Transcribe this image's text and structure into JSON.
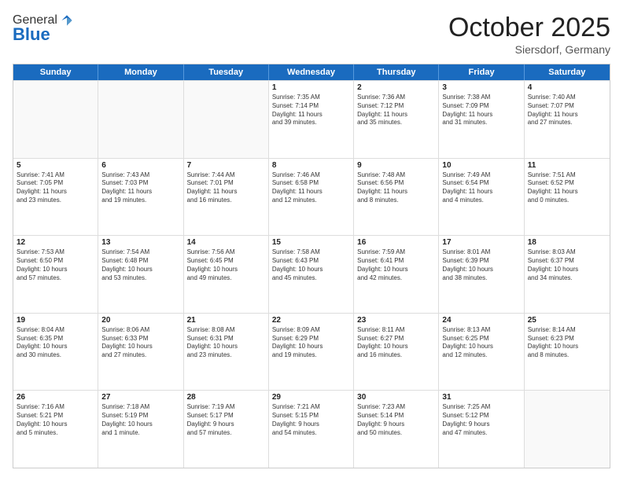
{
  "header": {
    "logo_general": "General",
    "logo_blue": "Blue",
    "title": "October 2025",
    "location": "Siersdorf, Germany"
  },
  "weekdays": [
    "Sunday",
    "Monday",
    "Tuesday",
    "Wednesday",
    "Thursday",
    "Friday",
    "Saturday"
  ],
  "rows": [
    [
      {
        "day": "",
        "info": ""
      },
      {
        "day": "",
        "info": ""
      },
      {
        "day": "",
        "info": ""
      },
      {
        "day": "1",
        "info": "Sunrise: 7:35 AM\nSunset: 7:14 PM\nDaylight: 11 hours\nand 39 minutes."
      },
      {
        "day": "2",
        "info": "Sunrise: 7:36 AM\nSunset: 7:12 PM\nDaylight: 11 hours\nand 35 minutes."
      },
      {
        "day": "3",
        "info": "Sunrise: 7:38 AM\nSunset: 7:09 PM\nDaylight: 11 hours\nand 31 minutes."
      },
      {
        "day": "4",
        "info": "Sunrise: 7:40 AM\nSunset: 7:07 PM\nDaylight: 11 hours\nand 27 minutes."
      }
    ],
    [
      {
        "day": "5",
        "info": "Sunrise: 7:41 AM\nSunset: 7:05 PM\nDaylight: 11 hours\nand 23 minutes."
      },
      {
        "day": "6",
        "info": "Sunrise: 7:43 AM\nSunset: 7:03 PM\nDaylight: 11 hours\nand 19 minutes."
      },
      {
        "day": "7",
        "info": "Sunrise: 7:44 AM\nSunset: 7:01 PM\nDaylight: 11 hours\nand 16 minutes."
      },
      {
        "day": "8",
        "info": "Sunrise: 7:46 AM\nSunset: 6:58 PM\nDaylight: 11 hours\nand 12 minutes."
      },
      {
        "day": "9",
        "info": "Sunrise: 7:48 AM\nSunset: 6:56 PM\nDaylight: 11 hours\nand 8 minutes."
      },
      {
        "day": "10",
        "info": "Sunrise: 7:49 AM\nSunset: 6:54 PM\nDaylight: 11 hours\nand 4 minutes."
      },
      {
        "day": "11",
        "info": "Sunrise: 7:51 AM\nSunset: 6:52 PM\nDaylight: 11 hours\nand 0 minutes."
      }
    ],
    [
      {
        "day": "12",
        "info": "Sunrise: 7:53 AM\nSunset: 6:50 PM\nDaylight: 10 hours\nand 57 minutes."
      },
      {
        "day": "13",
        "info": "Sunrise: 7:54 AM\nSunset: 6:48 PM\nDaylight: 10 hours\nand 53 minutes."
      },
      {
        "day": "14",
        "info": "Sunrise: 7:56 AM\nSunset: 6:45 PM\nDaylight: 10 hours\nand 49 minutes."
      },
      {
        "day": "15",
        "info": "Sunrise: 7:58 AM\nSunset: 6:43 PM\nDaylight: 10 hours\nand 45 minutes."
      },
      {
        "day": "16",
        "info": "Sunrise: 7:59 AM\nSunset: 6:41 PM\nDaylight: 10 hours\nand 42 minutes."
      },
      {
        "day": "17",
        "info": "Sunrise: 8:01 AM\nSunset: 6:39 PM\nDaylight: 10 hours\nand 38 minutes."
      },
      {
        "day": "18",
        "info": "Sunrise: 8:03 AM\nSunset: 6:37 PM\nDaylight: 10 hours\nand 34 minutes."
      }
    ],
    [
      {
        "day": "19",
        "info": "Sunrise: 8:04 AM\nSunset: 6:35 PM\nDaylight: 10 hours\nand 30 minutes."
      },
      {
        "day": "20",
        "info": "Sunrise: 8:06 AM\nSunset: 6:33 PM\nDaylight: 10 hours\nand 27 minutes."
      },
      {
        "day": "21",
        "info": "Sunrise: 8:08 AM\nSunset: 6:31 PM\nDaylight: 10 hours\nand 23 minutes."
      },
      {
        "day": "22",
        "info": "Sunrise: 8:09 AM\nSunset: 6:29 PM\nDaylight: 10 hours\nand 19 minutes."
      },
      {
        "day": "23",
        "info": "Sunrise: 8:11 AM\nSunset: 6:27 PM\nDaylight: 10 hours\nand 16 minutes."
      },
      {
        "day": "24",
        "info": "Sunrise: 8:13 AM\nSunset: 6:25 PM\nDaylight: 10 hours\nand 12 minutes."
      },
      {
        "day": "25",
        "info": "Sunrise: 8:14 AM\nSunset: 6:23 PM\nDaylight: 10 hours\nand 8 minutes."
      }
    ],
    [
      {
        "day": "26",
        "info": "Sunrise: 7:16 AM\nSunset: 5:21 PM\nDaylight: 10 hours\nand 5 minutes."
      },
      {
        "day": "27",
        "info": "Sunrise: 7:18 AM\nSunset: 5:19 PM\nDaylight: 10 hours\nand 1 minute."
      },
      {
        "day": "28",
        "info": "Sunrise: 7:19 AM\nSunset: 5:17 PM\nDaylight: 9 hours\nand 57 minutes."
      },
      {
        "day": "29",
        "info": "Sunrise: 7:21 AM\nSunset: 5:15 PM\nDaylight: 9 hours\nand 54 minutes."
      },
      {
        "day": "30",
        "info": "Sunrise: 7:23 AM\nSunset: 5:14 PM\nDaylight: 9 hours\nand 50 minutes."
      },
      {
        "day": "31",
        "info": "Sunrise: 7:25 AM\nSunset: 5:12 PM\nDaylight: 9 hours\nand 47 minutes."
      },
      {
        "day": "",
        "info": ""
      }
    ]
  ]
}
